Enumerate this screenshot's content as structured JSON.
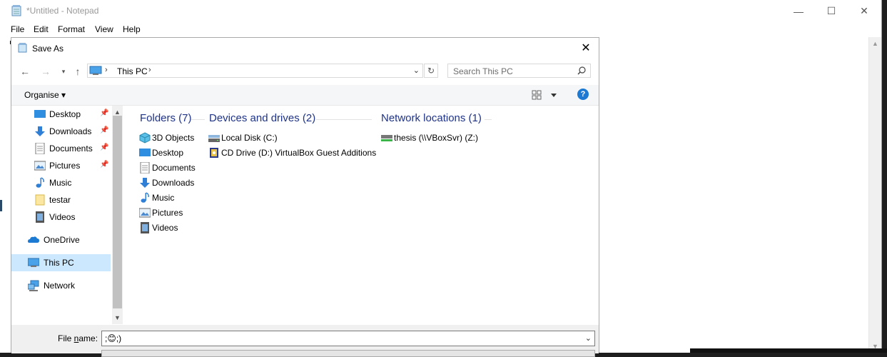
{
  "notepad": {
    "title": "*Untitled - Notepad",
    "menu": [
      "File",
      "Edit",
      "Format",
      "View",
      "Help"
    ],
    "window_controls": {
      "minimize": "—",
      "maximize": "☐",
      "close": "✕"
    }
  },
  "dialog": {
    "title": "Save As",
    "close": "✕",
    "address": {
      "location": "This PC"
    },
    "search_placeholder": "Search This PC",
    "organise_label": "Organise",
    "help_label": "?",
    "nav_items": [
      {
        "label": "Desktop",
        "icon": "desktop-icon",
        "pinned": true
      },
      {
        "label": "Downloads",
        "icon": "downloads-icon",
        "pinned": true
      },
      {
        "label": "Documents",
        "icon": "documents-icon",
        "pinned": true
      },
      {
        "label": "Pictures",
        "icon": "pictures-icon",
        "pinned": true
      },
      {
        "label": "Music",
        "icon": "music-icon",
        "pinned": false
      },
      {
        "label": "testar",
        "icon": "folder-icon",
        "pinned": false
      },
      {
        "label": "Videos",
        "icon": "videos-icon",
        "pinned": false
      },
      {
        "label": "OneDrive",
        "icon": "onedrive-icon",
        "pinned": false
      },
      {
        "label": "This PC",
        "icon": "this-pc-icon",
        "pinned": false,
        "selected": true
      },
      {
        "label": "Network",
        "icon": "network-icon",
        "pinned": false
      }
    ],
    "groups": {
      "folders": {
        "header": "Folders (7)",
        "items": [
          "3D Objects",
          "Desktop",
          "Documents",
          "Downloads",
          "Music",
          "Pictures",
          "Videos"
        ]
      },
      "devices": {
        "header": "Devices and drives (2)",
        "items": [
          "Local Disk (C:)",
          "CD Drive (D:) VirtualBox Guest Additions"
        ]
      },
      "network": {
        "header": "Network locations (1)",
        "items": [
          "thesis (\\\\VBoxSvr) (Z:)"
        ]
      }
    },
    "file_name": {
      "label_pre": "File ",
      "label_mnemonic": "n",
      "label_post": "ame:",
      "value": ";😊;)"
    }
  },
  "colors": {
    "accent": "#1c7ad2",
    "selected_bg": "#cce8ff",
    "group_header": "#1e3287"
  }
}
